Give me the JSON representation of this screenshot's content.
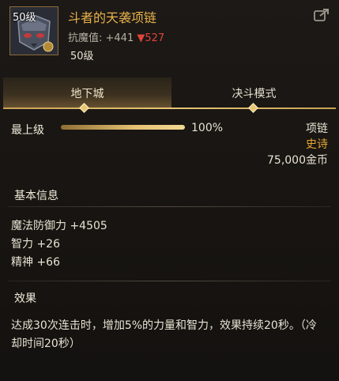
{
  "header": {
    "level_tag": "50级",
    "item_name": "斗者的天袭项链",
    "stat_label": "抗魔值: +441",
    "stat_down": "▼527",
    "level": "50级",
    "share_icon": "share-icon"
  },
  "tabs": [
    {
      "label": "地下城",
      "active": true
    },
    {
      "label": "决斗模式",
      "active": false
    }
  ],
  "grade": {
    "label": "最上级",
    "percent_text": "100%",
    "fill": 1.0
  },
  "item_info": {
    "slot": "项链",
    "rarity": "史诗",
    "price": "75,000金币"
  },
  "basic_info": {
    "title": "基本信息",
    "lines": [
      "魔法防御力 +4505",
      "智力 +26",
      "精神 +66"
    ]
  },
  "effect": {
    "title": "效果",
    "text": "达成30次连击时，增加5%的力量和智力，效果持续20秒。（冷却时间20秒）"
  },
  "colors": {
    "title_gold": "#e9b24a",
    "rarity_orange": "#e8a733",
    "stat_down_red": "#e0433a",
    "tab_accent": "#e8c677"
  }
}
